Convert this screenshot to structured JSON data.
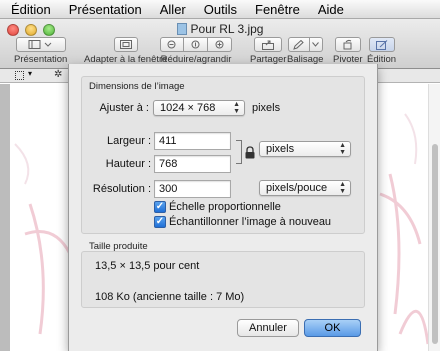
{
  "menubar": {
    "items": [
      "Édition",
      "Présentation",
      "Aller",
      "Outils",
      "Fenêtre",
      "Aide"
    ]
  },
  "window": {
    "title": "Pour RL 3.jpg"
  },
  "toolbar": {
    "presentation_label": "Présentation",
    "fit_label": "Adapter à la fenêtre",
    "zoom_label": "Réduire/agrandir",
    "share_label": "Partager",
    "markup_label": "Balisage",
    "rotate_label": "Pivoter",
    "edit_label": "Édition"
  },
  "dialog": {
    "dimensions_title": "Dimensions de l’image",
    "fit_label": "Ajuster à :",
    "fit_value": "1024 × 768",
    "fit_unit": "pixels",
    "width_label": "Largeur :",
    "width_value": "411",
    "height_label": "Hauteur :",
    "height_value": "768",
    "size_unit": "pixels",
    "resolution_label": "Résolution :",
    "resolution_value": "300",
    "resolution_unit": "pixels/pouce",
    "scale_checkbox": "Échelle proportionnelle",
    "resample_checkbox": "Échantillonner l’image à nouveau",
    "result_title": "Taille produite",
    "result_percent": "13,5 × 13,5 pour cent",
    "result_size": "108 Ko (ancienne taille : 7 Mo)",
    "cancel_label": "Annuler",
    "ok_label": "OK"
  },
  "colors": {
    "accent": "#5a9ae6",
    "checkbox": "#1f6fd6"
  }
}
